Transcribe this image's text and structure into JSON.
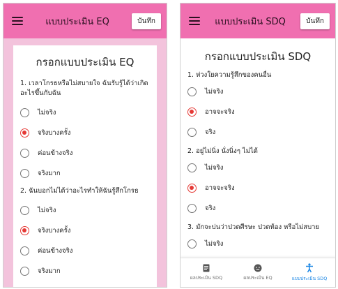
{
  "screen_eq": {
    "appbar": {
      "title": "แบบประเมิน EQ",
      "save_label": "บันทึก"
    },
    "form_title": "กรอกแบบประเมิน EQ",
    "questions": [
      {
        "text": "1. เวลาโกรธหรือไม่สบายใจ ฉันรับรู้ได้ว่าเกิดอะไรขึ้นกับฉัน",
        "options": [
          "ไม่จริง",
          "จริงบางครั้ง",
          "ค่อนข้างจริง",
          "จริงมาก"
        ],
        "selected": "จริงบางครั้ง"
      },
      {
        "text": "2. ฉันบอกไม่ได้ว่าอะไรทำให้ฉันรู้สึกโกรธ",
        "options": [
          "ไม่จริง",
          "จริงบางครั้ง",
          "ค่อนข้างจริง",
          "จริงมาก"
        ],
        "selected": "จริงบางครั้ง"
      }
    ]
  },
  "screen_sdq": {
    "appbar": {
      "title": "แบบประเมิน SDQ",
      "save_label": "บันทึก"
    },
    "form_title": "กรอกแบบประเมิน SDQ",
    "questions": [
      {
        "text": "1. ห่วงใยความรู้สึกของคนอื่น",
        "options": [
          "ไม่จริง",
          "อาจจะจริง",
          "จริง"
        ],
        "selected": "อาจจะจริง"
      },
      {
        "text": "2. อยู่ไม่นิ่ง นั่งนิ่งๆ ไม่ได้",
        "options": [
          "ไม่จริง",
          "อาจจะจริง",
          "จริง"
        ],
        "selected": "อาจจะจริง"
      },
      {
        "text": "3. มักจะบ่นว่าปวดศีรษะ ปวดท้อง หรือไม่สบาย",
        "options": [
          "ไม่จริง"
        ],
        "selected": ""
      }
    ],
    "bottom_nav": [
      {
        "label": "ผลประเมิน SDQ",
        "icon": "document-icon",
        "active": false
      },
      {
        "label": "ผลประเมิน EQ",
        "icon": "face-icon",
        "active": false
      },
      {
        "label": "แบบประเมิน SDQ",
        "icon": "person-icon",
        "active": true
      }
    ]
  },
  "colors": {
    "appbar": "#f06fb0",
    "eq_background": "#f3c3dc",
    "radio_selected": "#e53935",
    "nav_active": "#1e88e5"
  }
}
